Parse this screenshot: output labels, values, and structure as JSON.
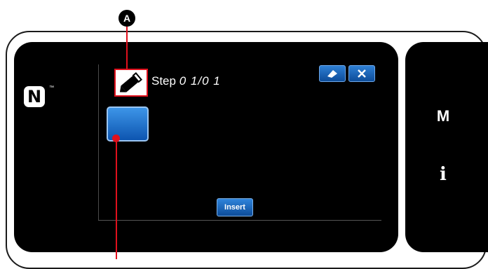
{
  "callouts": {
    "a": "A"
  },
  "header": {
    "step_prefix": "Step",
    "step_value": "0 1/0 1"
  },
  "sidebar": {
    "mode_label": "M",
    "info_label": "i"
  },
  "buttons": {
    "insert_label": "Insert"
  },
  "brand": {
    "nfc_symbol": "N",
    "trademark": "™"
  },
  "colors": {
    "accent": "#e0101d",
    "button_blue": "#1a6fcf",
    "background": "#000000"
  }
}
